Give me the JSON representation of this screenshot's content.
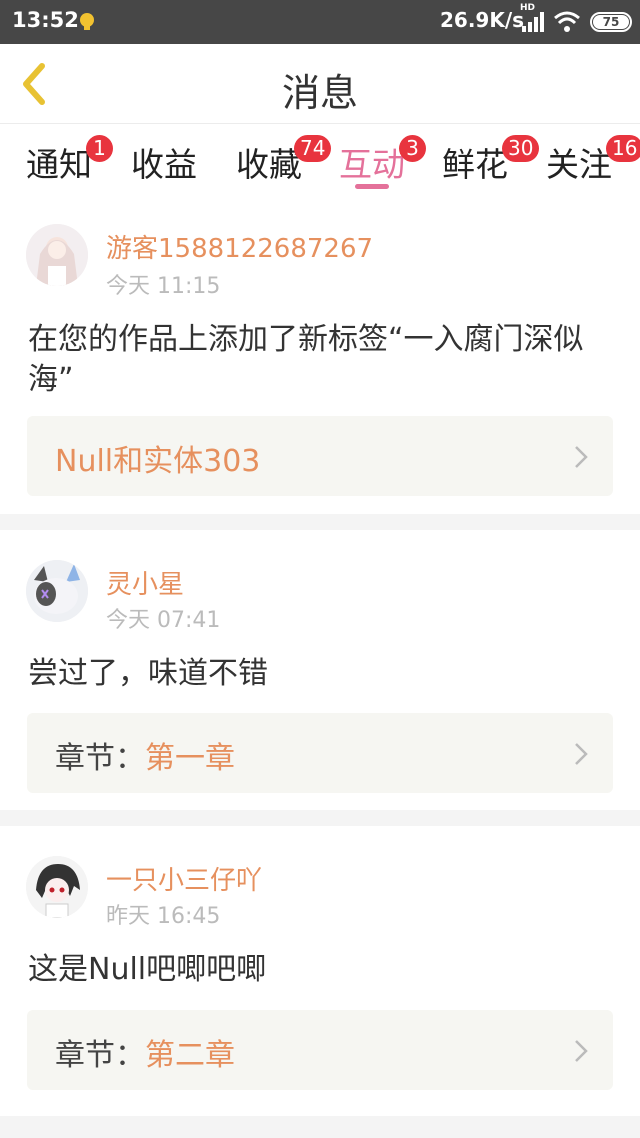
{
  "status_bar": {
    "time": "13:52",
    "network_speed": "26.9K/s",
    "hd_label": "HD",
    "battery": "75"
  },
  "header": {
    "title": "消息"
  },
  "tabs": [
    {
      "label": "通知",
      "badge": "1"
    },
    {
      "label": "收益",
      "badge": ""
    },
    {
      "label": "收藏",
      "badge": "74"
    },
    {
      "label": "互动",
      "badge": "3",
      "active": true
    },
    {
      "label": "鲜花",
      "badge": "30"
    },
    {
      "label": "关注",
      "badge": "16"
    }
  ],
  "messages": [
    {
      "user": "游客1588122687267",
      "time": "今天 11:15",
      "content": "在您的作品上添加了新标签“一入腐门深似海”",
      "link_label": "",
      "link_value": "Null和实体303"
    },
    {
      "user": "灵小星",
      "time": "今天 07:41",
      "content": "尝过了，味道不错",
      "link_label": "章节：",
      "link_value": "第一章"
    },
    {
      "user": "一只小三仔吖",
      "time": "昨天 16:45",
      "content": "这是Null吧唧吧唧",
      "link_label": "章节：",
      "link_value": "第二章"
    }
  ],
  "colors": {
    "accent_pink": "#e4719a",
    "accent_orange": "#e6905e",
    "badge_red": "#e8343e",
    "back_yellow": "#e8c233"
  },
  "icons": {
    "back": "chevron-left-icon",
    "chevron": "chevron-right-icon",
    "wifi": "wifi-icon",
    "signal": "signal-icon",
    "battery": "battery-icon"
  }
}
